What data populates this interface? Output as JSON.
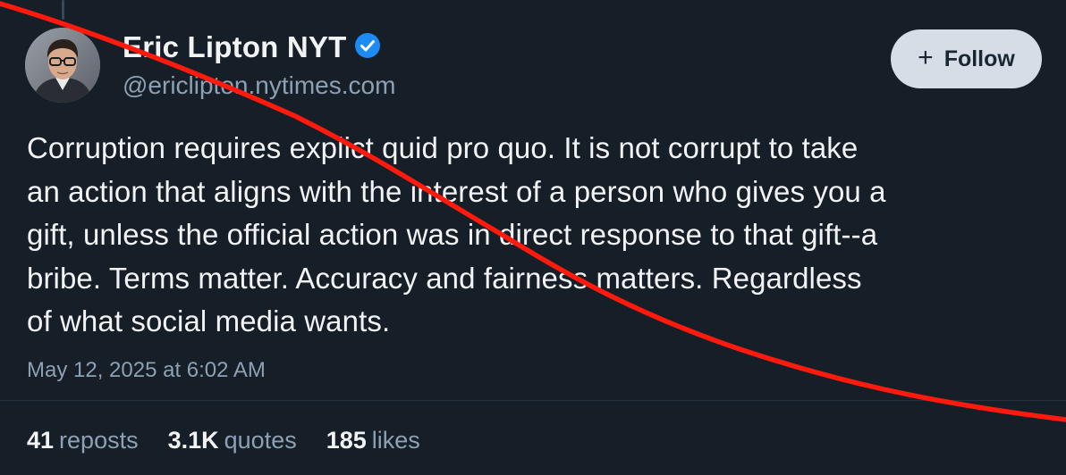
{
  "author": {
    "display_name": "Eric Lipton NYT",
    "handle": "@ericlipton.nytimes.com",
    "verified": true
  },
  "follow_button": {
    "icon": "plus-icon",
    "label": "Follow"
  },
  "post": {
    "text_lines": [
      "Corruption requires explict quid pro quo. It is not corrupt to take",
      "an action that aligns with the interest of a person who gives you a",
      "gift, unless the official action was in direct response to that gift--a",
      "bribe. Terms matter. Accuracy and fairness matters. Regardless",
      "of what social media wants."
    ],
    "timestamp": "May 12, 2025 at 6:02 AM"
  },
  "stats": {
    "reposts": {
      "count": "41",
      "label": "reposts"
    },
    "quotes": {
      "count": "3.1K",
      "label": "quotes"
    },
    "likes": {
      "count": "185",
      "label": "likes"
    }
  },
  "colors": {
    "background": "#161e27",
    "verified_badge": "#1d8bf5",
    "annotation_line": "#ff1a0d",
    "follow_button_bg": "#d6dde6"
  }
}
